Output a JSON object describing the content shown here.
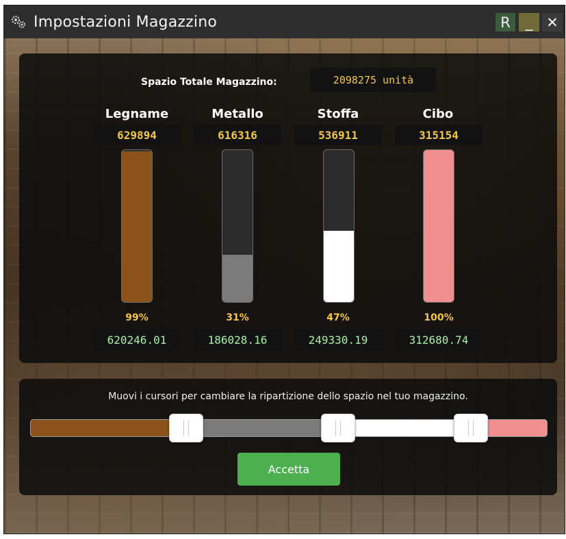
{
  "window": {
    "title": "Impostazioni Magazzino",
    "icon": "gears-icon",
    "buttons": {
      "reset": "R",
      "minimize": "_",
      "close": "✕"
    }
  },
  "total": {
    "label": "Spazio Totale Magazzino:",
    "value": "2098275 unità"
  },
  "resources": [
    {
      "name": "Legname",
      "capacity": "629894",
      "percent_label": "99%",
      "fill_fraction": 0.99,
      "used": "620246.01",
      "color": "#8b5219"
    },
    {
      "name": "Metallo",
      "capacity": "616316",
      "percent_label": "31%",
      "fill_fraction": 0.31,
      "used": "186028.16",
      "color": "#7a7a7a"
    },
    {
      "name": "Stoffa",
      "capacity": "536911",
      "percent_label": "47%",
      "fill_fraction": 0.47,
      "used": "249330.19",
      "color": "#ffffff"
    },
    {
      "name": "Cibo",
      "capacity": "315154",
      "percent_label": "100%",
      "fill_fraction": 1.0,
      "used": "312680.74",
      "color": "#f08f8f"
    }
  ],
  "allocation": {
    "instructions": "Muovi i cursori per cambiare la ripartizione dello spazio nel tuo magazzino.",
    "shares": [
      0.3,
      0.294,
      0.256,
      0.15
    ]
  },
  "accept_label": "Accetta",
  "colors": {
    "accent_yellow": "#f4c64a",
    "used_green": "#a8f0a8",
    "accept_green": "#4caf50"
  }
}
